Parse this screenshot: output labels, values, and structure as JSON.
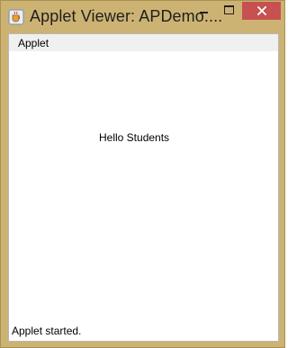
{
  "window": {
    "title": "Applet Viewer: APDemo....",
    "icon": "java-cup-icon",
    "controls": {
      "minimize": "minimize-icon",
      "maximize": "maximize-icon",
      "close": "close-icon"
    },
    "close_color": "#c75050",
    "frame_color": "#cdb373"
  },
  "menubar": {
    "items": [
      {
        "label": "Applet"
      }
    ]
  },
  "applet": {
    "message": "Hello Students"
  },
  "statusbar": {
    "text": "Applet started."
  }
}
